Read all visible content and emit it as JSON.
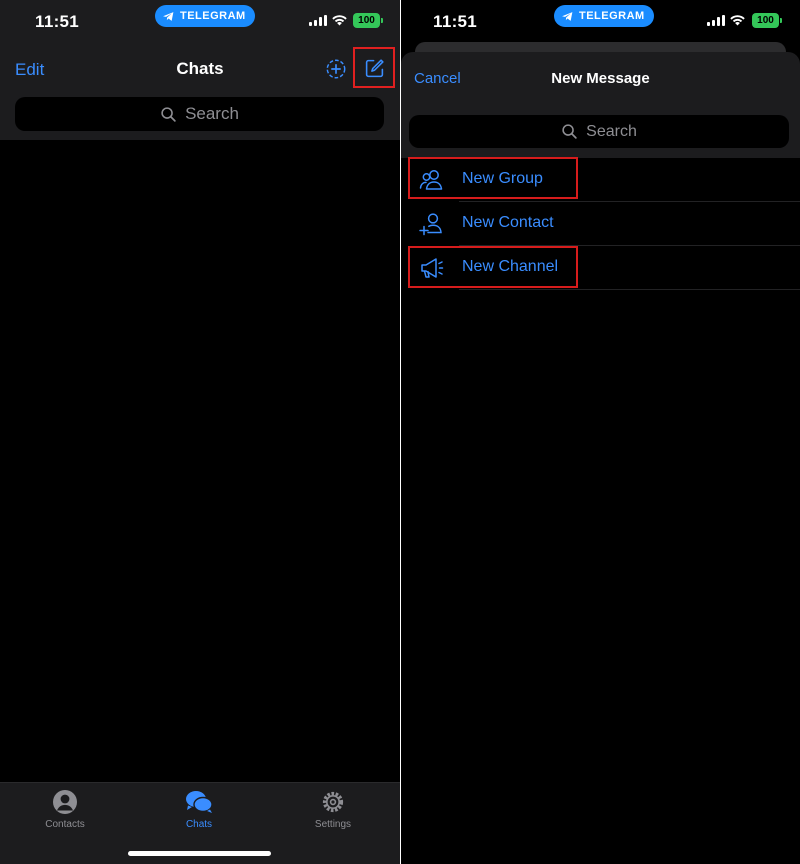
{
  "left_screen": {
    "status": {
      "time": "11:51",
      "app_pill": "TELEGRAM",
      "battery": "100"
    },
    "nav": {
      "edit_label": "Edit",
      "title": "Chats"
    },
    "search": {
      "placeholder": "Search"
    },
    "tabbar": [
      {
        "label": "Contacts",
        "icon": "person-circle-icon",
        "active": false
      },
      {
        "label": "Chats",
        "icon": "chat-bubbles-icon",
        "active": true
      },
      {
        "label": "Settings",
        "icon": "gear-icon",
        "active": false
      }
    ]
  },
  "right_screen": {
    "status": {
      "time": "11:51",
      "app_pill": "TELEGRAM",
      "battery": "100"
    },
    "sheet": {
      "cancel_label": "Cancel",
      "title": "New Message"
    },
    "search": {
      "placeholder": "Search"
    },
    "menu": [
      {
        "label": "New Group",
        "icon": "group-icon"
      },
      {
        "label": "New Contact",
        "icon": "add-contact-icon"
      },
      {
        "label": "New Channel",
        "icon": "megaphone-icon"
      }
    ]
  },
  "colors": {
    "accent": "#3a8dff",
    "highlight": "#d61c1c",
    "battery": "#34c759",
    "background": "#000000",
    "bar": "#1c1c1e"
  }
}
